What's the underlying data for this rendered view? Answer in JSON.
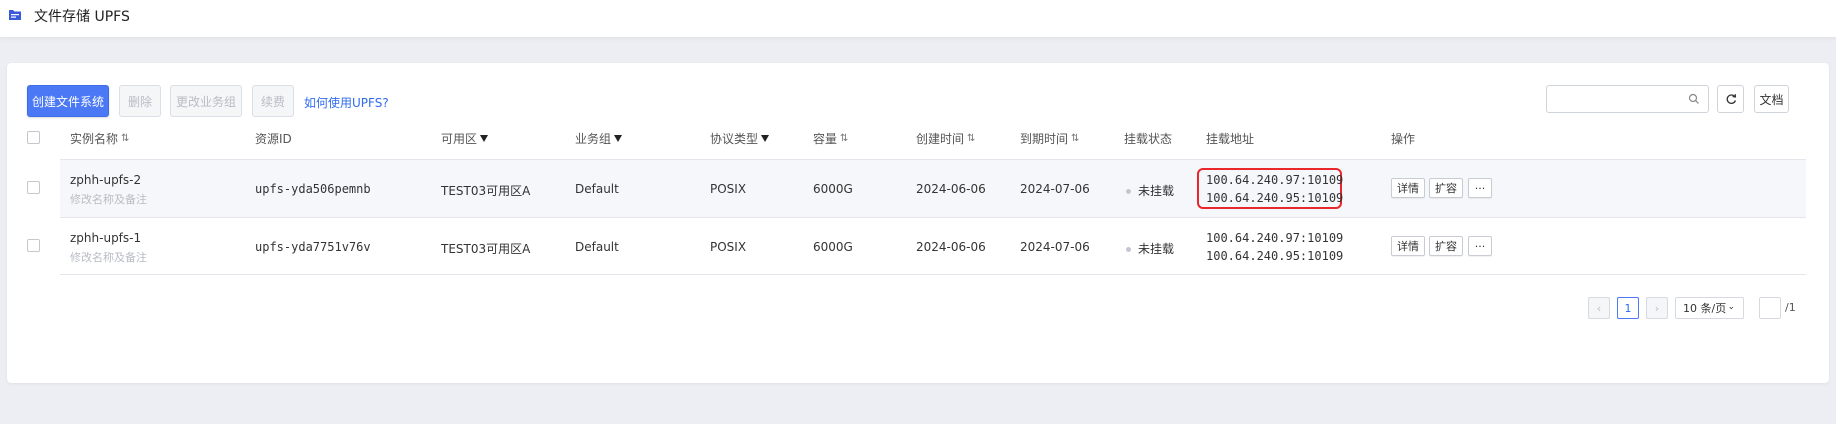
{
  "header": {
    "title": "文件存储 UPFS",
    "icon": "folder-icon"
  },
  "toolbar": {
    "create": "创建文件系统",
    "delete": "删除",
    "change_group": "更改业务组",
    "renew": "续费",
    "help_link": "如何使用UPFS?",
    "search_placeholder": "",
    "docs": "文档"
  },
  "table": {
    "columns": {
      "name": "实例名称",
      "resource_id": "资源ID",
      "zone": "可用区",
      "group": "业务组",
      "protocol": "协议类型",
      "capacity": "容量",
      "created": "创建时间",
      "expires": "到期时间",
      "mount_status": "挂载状态",
      "mount_addr": "挂载地址",
      "actions": "操作"
    },
    "rows": [
      {
        "name": "zphh-upfs-2",
        "note": "修改名称及备注",
        "resource_id": "upfs-yda506pemnb",
        "zone": "TEST03可用区A",
        "group": "Default",
        "protocol": "POSIX",
        "capacity": "6000G",
        "created": "2024-06-06",
        "expires": "2024-07-06",
        "status": "未挂载",
        "addr1": "100.64.240.97:10109",
        "addr2": "100.64.240.95:10109",
        "detail": "详情",
        "expand": "扩容",
        "more": "···"
      },
      {
        "name": "zphh-upfs-1",
        "note": "修改名称及备注",
        "resource_id": "upfs-yda7751v76v",
        "zone": "TEST03可用区A",
        "group": "Default",
        "protocol": "POSIX",
        "capacity": "6000G",
        "created": "2024-06-06",
        "expires": "2024-07-06",
        "status": "未挂载",
        "addr1": "100.64.240.97:10109",
        "addr2": "100.64.240.95:10109",
        "detail": "详情",
        "expand": "扩容",
        "more": "···"
      }
    ]
  },
  "pagination": {
    "prev": "‹",
    "current": "1",
    "next": "›",
    "page_size": "10 条/页",
    "jump_value": "",
    "total": "/1"
  },
  "colors": {
    "primary": "#4b78f5",
    "highlight_border": "#e8262c",
    "link": "#2f6bf0"
  }
}
